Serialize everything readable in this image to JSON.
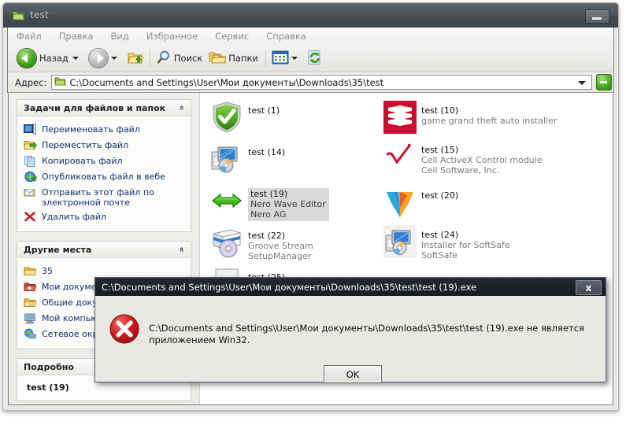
{
  "window": {
    "title": "test",
    "icon": "folder-icon",
    "minimize_label": "Свернуть"
  },
  "menubar": {
    "items": [
      {
        "label": "Файл"
      },
      {
        "label": "Правка"
      },
      {
        "label": "Вид"
      },
      {
        "label": "Избранное"
      },
      {
        "label": "Сервис"
      },
      {
        "label": "Справка"
      }
    ]
  },
  "toolbar": {
    "back_label": "Назад",
    "search_label": "Поиск",
    "folders_label": "Папки",
    "forward_label": "Вперёд",
    "up_label": "Вверх",
    "views_label": "Вид",
    "refresh_label": "Обновить"
  },
  "address": {
    "label": "Адрес:",
    "value": "C:\\Documents and Settings\\User\\Мои документы\\Downloads\\35\\test",
    "go_label": "Переход"
  },
  "sidebar": {
    "panels": [
      {
        "title": "Задачи для файлов и папок",
        "collapse_glyph": "«",
        "items": [
          {
            "label": "Переименовать файл",
            "icon": "rename-icon"
          },
          {
            "label": "Переместить файл",
            "icon": "move-folder-icon"
          },
          {
            "label": "Копировать файл",
            "icon": "copy-page-icon"
          },
          {
            "label": "Опубликовать файл в вебе",
            "icon": "globe-icon"
          },
          {
            "label": "Отправить этот файл по электронной почте",
            "icon": "mail-icon"
          },
          {
            "label": "Удалить файл",
            "icon": "delete-x-icon"
          }
        ]
      },
      {
        "title": "Другие места",
        "collapse_glyph": "«",
        "items": [
          {
            "label": "35",
            "icon": "folder-yellow-icon"
          },
          {
            "label": "Мои документы",
            "icon": "my-documents-icon"
          },
          {
            "label": "Общие документы",
            "icon": "shared-documents-icon"
          },
          {
            "label": "Мой компьютер",
            "icon": "my-computer-icon"
          },
          {
            "label": "Сетевое окружение",
            "icon": "network-icon"
          }
        ]
      },
      {
        "title": "Подробно",
        "collapse_glyph": "«",
        "detail_name": "test (19)"
      }
    ]
  },
  "filelist": {
    "items": [
      {
        "name": "test (1)",
        "desc": "",
        "company": "",
        "icon": "green-shield-check-icon",
        "selected": false
      },
      {
        "name": "test (14)",
        "desc": "",
        "company": "",
        "icon": "setup-installer-icon",
        "selected": false
      },
      {
        "name": "test (19)",
        "desc": "Nero Wave Editor",
        "company": "Nero AG",
        "icon": "green-double-arrow-icon",
        "selected": true
      },
      {
        "name": "test (22)",
        "desc": "Groove Stream",
        "company": "SetupManager",
        "icon": "cd-box-icon",
        "selected": false
      },
      {
        "name": "test (10)",
        "desc": "game grand theft auto installer",
        "company": "",
        "icon": "red-chevrons-icon",
        "selected": false
      },
      {
        "name": "test (15)",
        "desc": "Cell ActiveX Control module",
        "company": "Cell Software, Inc.",
        "icon": "red-checkmark-icon",
        "selected": false
      },
      {
        "name": "test (20)",
        "desc": "",
        "company": "",
        "icon": "blue-orange-arrow-icon",
        "selected": false
      },
      {
        "name": "test (24)",
        "desc": "Installer for SoftSafe",
        "company": "SoftSafe",
        "icon": "setup-installer-icon",
        "selected": false
      }
    ]
  },
  "dialog": {
    "title": "C:\\Documents and Settings\\User\\Мои документы\\Downloads\\35\\test\\test (19).exe",
    "message": "C:\\Documents and Settings\\User\\Мои документы\\Downloads\\35\\test\\test (19).exe не является приложением Win32.",
    "ok_label": "OK",
    "close_label": "x",
    "icon": "error-x-icon"
  },
  "colors": {
    "titlebar": "#474e57",
    "dialog_titlebar": "#1d222a",
    "accent_link": "#13306e",
    "error_red": "#c8102e",
    "selection": "#d9d9d9"
  }
}
